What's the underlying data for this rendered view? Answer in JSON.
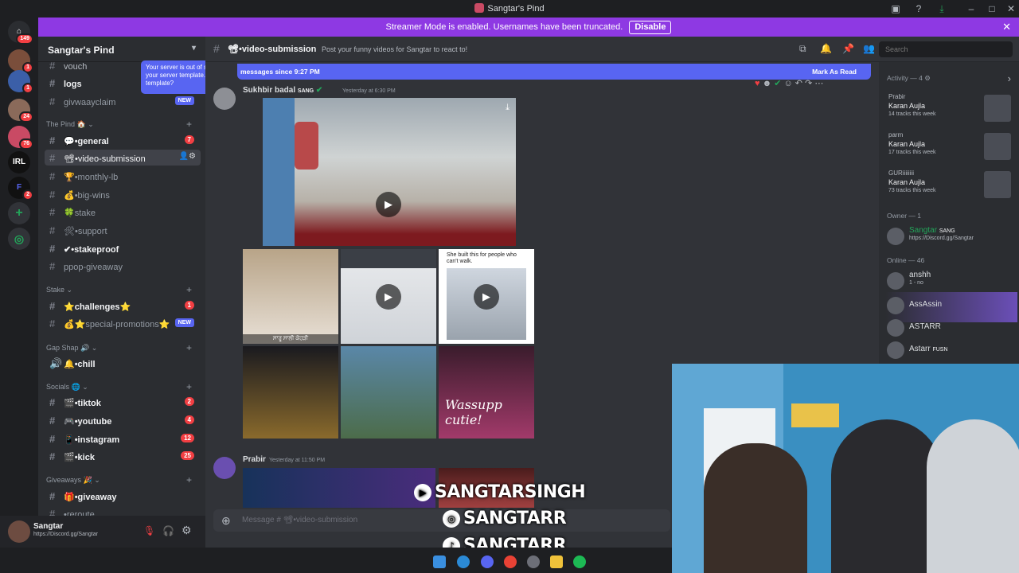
{
  "window": {
    "title": "Sangtar's Pind"
  },
  "banner": {
    "text": "Streamer Mode is enabled. Usernames have been truncated.",
    "button": "Disable"
  },
  "rail": {
    "badges": [
      "149",
      "1",
      "1",
      "24",
      "76",
      "2"
    ],
    "irl": "IRL",
    "f": "F"
  },
  "server": {
    "name": "Sangtar's Pind"
  },
  "tooltip": {
    "text": "Your server is out of sync with your server template. Sync template?"
  },
  "channels": {
    "vouch": "vouch",
    "logs": "logs",
    "givwaway": "givwaayclaim",
    "givwaway_badge": "NEW",
    "cat_pind": "The Pind 🏠",
    "general": "💬•general",
    "general_count": "7",
    "video_submission": "📽•video-submission",
    "monthly": "🏆•monthly-lb",
    "bigwins": "💰•big-wins",
    "stake": "🍀stake",
    "support": "🛠•support",
    "stakeproof": "✔•stakeproof",
    "ppop": "ppop-giveaway",
    "cat_stake": "Stake",
    "challenges": "⭐challenges⭐",
    "challenges_count": "1",
    "special": "💰⭐special-promotions⭐",
    "special_badge": "NEW",
    "cat_gap": "Gap Shap 🔊",
    "chill": "🔔•chill",
    "cat_socials": "Socials 🌐",
    "tiktok": "🎬•tiktok",
    "tiktok_count": "2",
    "youtube": "🎮•youtube",
    "youtube_count": "4",
    "instagram": "📱•instagram",
    "instagram_count": "12",
    "kick": "🎬•kick",
    "kick_count": "25",
    "cat_giveaways": "Giveaways 🎉",
    "giveaway": "🎁•giveaway",
    "reroute": "•reroute"
  },
  "user": {
    "name": "Sangtar",
    "status": "https://Discord.gg/Sangtar"
  },
  "header": {
    "channel": "📽•video-submission",
    "topic": "Post your funny videos for Sangtar to react to!",
    "search_placeholder": "Search"
  },
  "newbar": {
    "text": "messages since 9:27 PM",
    "mark": "Mark As Read"
  },
  "messages": [
    {
      "author": "Sukhbir badal",
      "tag": "SANG",
      "time": "Yesterday at 6:30 PM"
    },
    {
      "author": "Prabir",
      "time": "Yesterday at 11:50 PM"
    }
  ],
  "tile_texts": {
    "t3": "She built this for people who can't walk.",
    "t1": "ਸਾਰੂ ਸਾਲੀ ਕੋਹੜੀ",
    "t6": "Wassupp cutie!"
  },
  "composer": {
    "placeholder": "Message # 📽•video-submission"
  },
  "overlays": {
    "yt": "SANGTARSINGH",
    "ig": "SANGTARR",
    "tt": "SANGTARR"
  },
  "members": {
    "activity_label": "Activity — 4",
    "activity": [
      {
        "user": "Prabir",
        "artist": "Karan Aujla",
        "tracks": "14 tracks this week"
      },
      {
        "user": "parm",
        "artist": "Karan Aujla",
        "tracks": "17 tracks this week"
      },
      {
        "user": "GURiiiiiiii",
        "artist": "Karan Aujla",
        "tracks": "73 tracks this week"
      }
    ],
    "owner_label": "Owner — 1",
    "owner": {
      "name": "Sangtar",
      "tag": "SANG",
      "status": "https://Discord.gg/Sangtar"
    },
    "online_label": "Online — 46",
    "online": [
      {
        "name": "anshh",
        "status": "1 - no"
      },
      {
        "name": "AssAssin",
        "status": ""
      },
      {
        "name": "ASTARR",
        "status": ""
      },
      {
        "name": "Astarr",
        "tag": "FUSN",
        "status": ""
      }
    ]
  },
  "colors": {
    "accent": "#5865f2",
    "banner": "#8e39e3",
    "danger": "#f23f43",
    "owner": "#23a55a"
  }
}
